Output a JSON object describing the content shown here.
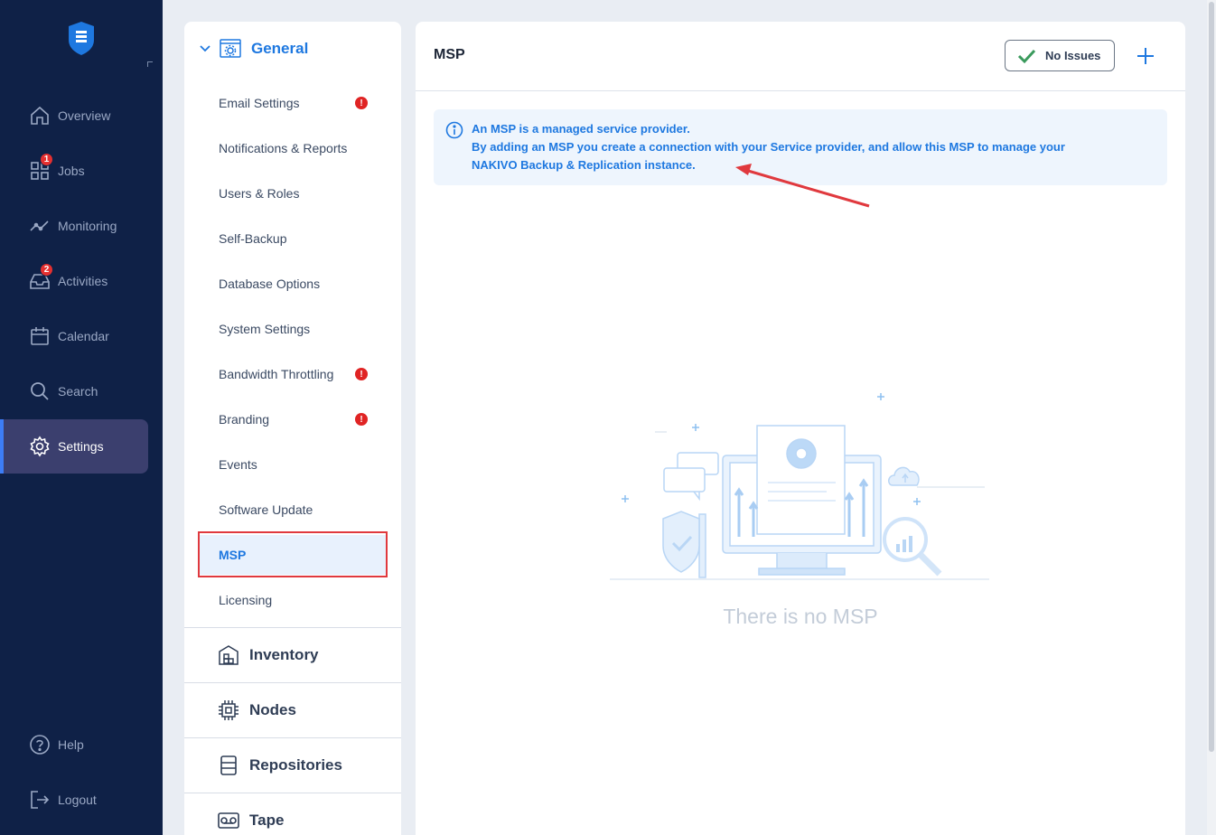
{
  "nav": {
    "items": [
      {
        "label": "Overview",
        "icon": "home-icon",
        "badge": ""
      },
      {
        "label": "Jobs",
        "icon": "jobs-icon",
        "badge": "1"
      },
      {
        "label": "Monitoring",
        "icon": "monitoring-icon",
        "badge": ""
      },
      {
        "label": "Activities",
        "icon": "activities-icon",
        "badge": "2"
      },
      {
        "label": "Calendar",
        "icon": "calendar-icon",
        "badge": ""
      },
      {
        "label": "Search",
        "icon": "search-icon",
        "badge": ""
      },
      {
        "label": "Settings",
        "icon": "gear-icon",
        "badge": "",
        "active": true
      }
    ],
    "help_label": "Help",
    "logout_label": "Logout"
  },
  "settings_menu": {
    "general_label": "General",
    "general_items": [
      {
        "label": "Email Settings",
        "warning": "!"
      },
      {
        "label": "Notifications & Reports",
        "warning": ""
      },
      {
        "label": "Users & Roles",
        "warning": ""
      },
      {
        "label": "Self-Backup",
        "warning": ""
      },
      {
        "label": "Database Options",
        "warning": ""
      },
      {
        "label": "System Settings",
        "warning": ""
      },
      {
        "label": "Bandwidth Throttling",
        "warning": "!"
      },
      {
        "label": "Branding",
        "warning": "!"
      },
      {
        "label": "Events",
        "warning": ""
      },
      {
        "label": "Software Update",
        "warning": ""
      },
      {
        "label": "MSP",
        "warning": "",
        "selected": true
      },
      {
        "label": "Licensing",
        "warning": ""
      }
    ],
    "sections": [
      {
        "label": "Inventory",
        "icon": "inventory-icon"
      },
      {
        "label": "Nodes",
        "icon": "nodes-icon"
      },
      {
        "label": "Repositories",
        "icon": "repositories-icon"
      },
      {
        "label": "Tape",
        "icon": "tape-icon"
      }
    ]
  },
  "main": {
    "title": "MSP",
    "status_label": "No Issues",
    "info_lines": [
      "An MSP is a managed service provider.",
      "By adding an MSP you create a connection with your Service provider, and allow this MSP to manage your",
      "NAKIVO Backup & Replication instance."
    ],
    "empty_text": "There is no MSP"
  },
  "colors": {
    "nav_bg": "#0f2147",
    "accent": "#1e78e0",
    "warning": "#e02424",
    "annotation": "#e0393e",
    "success": "#3a9a5c"
  }
}
